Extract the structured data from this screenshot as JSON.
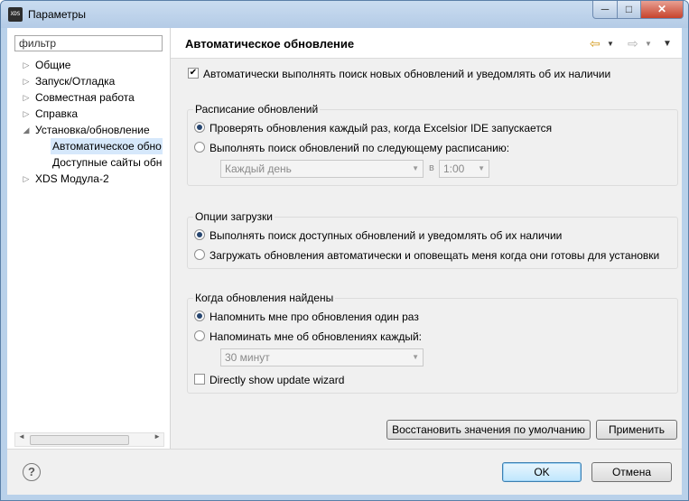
{
  "window": {
    "icon_text": "XDS",
    "title": "Параметры",
    "min_glyph": "─",
    "max_glyph": "□",
    "close_glyph": "✕"
  },
  "sidebar": {
    "filter_value": "фильтр",
    "items": [
      {
        "label": "Общие",
        "expandable": true
      },
      {
        "label": "Запуск/Отладка",
        "expandable": true
      },
      {
        "label": "Совместная работа",
        "expandable": true
      },
      {
        "label": "Справка",
        "expandable": true
      },
      {
        "label": "Установка/обновление",
        "expanded": true
      },
      {
        "label": "Автоматическое обно",
        "selected": true
      },
      {
        "label": "Доступные сайты обн"
      },
      {
        "label": "XDS Модула-2",
        "expandable": true
      }
    ],
    "scroll_left": "◄",
    "scroll_right": "►"
  },
  "page": {
    "title": "Автоматическое обновление",
    "nav_back": "⇦",
    "nav_forward": "⇨",
    "nav_dropdown": "▼",
    "menu": "▼",
    "auto_check_label": "Автоматически выполнять поиск новых обновлений и уведомлять об их наличии",
    "auto_check_checked": true
  },
  "schedule": {
    "title": "Расписание обновлений",
    "option1": "Проверять обновления каждый раз, когда Excelsior IDE запускается",
    "option2": "Выполнять поиск обновлений по следующему расписанию:",
    "selected": 1,
    "day_value": "Каждый день",
    "at_label": "в",
    "time_value": "1:00"
  },
  "download": {
    "title": "Опции загрузки",
    "option1": "Выполнять поиск доступных обновлений и уведомлять об их наличии",
    "option2": "Загружать обновления автоматически и оповещать меня когда они готовы для установки",
    "selected": 1
  },
  "found": {
    "title": "Когда обновления найдены",
    "option1": "Напомнить мне про обновления один раз",
    "option2": "Напоминать мне об обновлениях каждый:",
    "selected": 1,
    "interval_value": "30 минут",
    "wizard_label": "Directly show update wizard",
    "wizard_checked": false
  },
  "buttons": {
    "restore": "Восстановить значения по умолчанию",
    "apply": "Применить",
    "ok": "OK",
    "cancel": "Отмена",
    "help": "?"
  }
}
